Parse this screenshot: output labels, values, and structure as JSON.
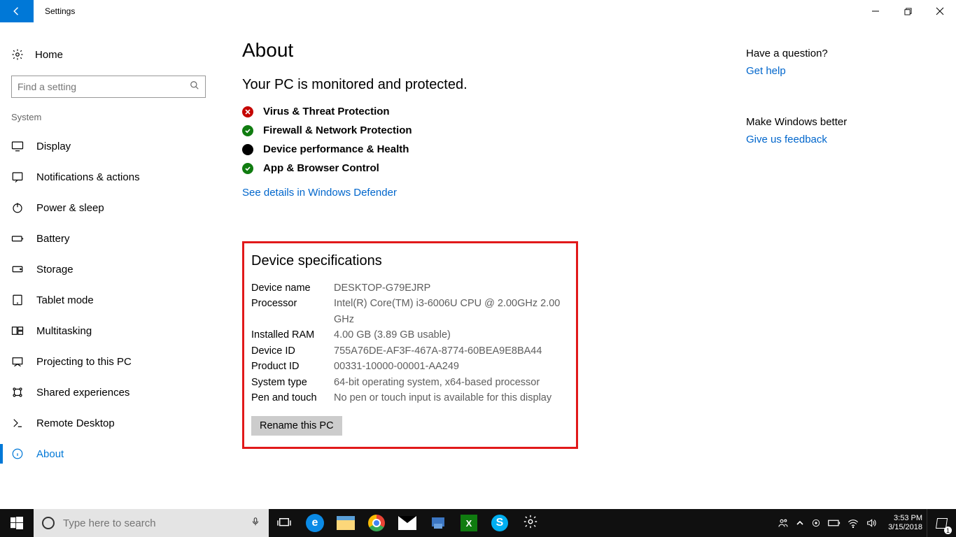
{
  "titlebar": {
    "title": "Settings"
  },
  "sidebar": {
    "home": "Home",
    "search_placeholder": "Find a setting",
    "section": "System",
    "items": [
      {
        "label": "Display"
      },
      {
        "label": "Notifications & actions"
      },
      {
        "label": "Power & sleep"
      },
      {
        "label": "Battery"
      },
      {
        "label": "Storage"
      },
      {
        "label": "Tablet mode"
      },
      {
        "label": "Multitasking"
      },
      {
        "label": "Projecting to this PC"
      },
      {
        "label": "Shared experiences"
      },
      {
        "label": "Remote Desktop"
      },
      {
        "label": "About"
      }
    ]
  },
  "main": {
    "title": "About",
    "protection_heading": "Your PC is monitored and protected.",
    "statuses": [
      {
        "label": "Virus & Threat Protection",
        "state": "red"
      },
      {
        "label": "Firewall & Network Protection",
        "state": "green"
      },
      {
        "label": "Device performance & Health",
        "state": "black"
      },
      {
        "label": "App & Browser Control",
        "state": "green"
      }
    ],
    "defender_link": "See details in Windows Defender",
    "spec_title": "Device specifications",
    "specs": {
      "device_name_label": "Device name",
      "device_name": "DESKTOP-G79EJRP",
      "processor_label": "Processor",
      "processor": "Intel(R) Core(TM) i3-6006U CPU @ 2.00GHz   2.00 GHz",
      "ram_label": "Installed RAM",
      "ram": "4.00 GB (3.89 GB usable)",
      "device_id_label": "Device ID",
      "device_id": "755A76DE-AF3F-467A-8774-60BEA9E8BA44",
      "product_id_label": "Product ID",
      "product_id": "00331-10000-00001-AA249",
      "system_type_label": "System type",
      "system_type": "64-bit operating system, x64-based processor",
      "pen_label": "Pen and touch",
      "pen": "No pen or touch input is available for this display"
    },
    "rename_btn": "Rename this PC"
  },
  "sidepanel": {
    "q_head": "Have a question?",
    "q_link": "Get help",
    "f_head": "Make Windows better",
    "f_link": "Give us feedback"
  },
  "taskbar": {
    "search_placeholder": "Type here to search",
    "time": "3:53 PM",
    "date": "3/15/2018",
    "notif_count": "1"
  }
}
